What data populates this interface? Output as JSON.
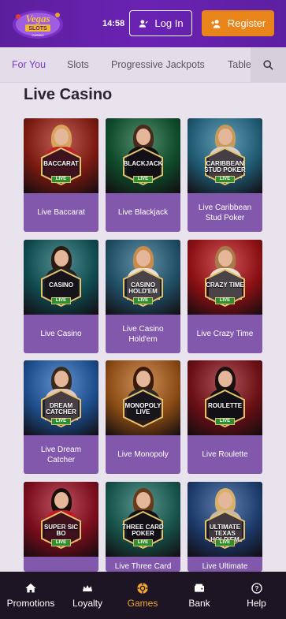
{
  "header": {
    "logo_text": "Vegas SLOTS CASINO",
    "time": "14:58",
    "login_label": "Log In",
    "register_label": "Register"
  },
  "tabs": [
    {
      "label": "For You",
      "active": true
    },
    {
      "label": "Slots",
      "active": false
    },
    {
      "label": "Progressive Jackpots",
      "active": false
    },
    {
      "label": "Table",
      "active": false
    }
  ],
  "section": {
    "title": "Live Casino"
  },
  "games": [
    {
      "label": "Live Baccarat",
      "badge": "BACCARAT",
      "live": "LIVE",
      "theme": "#7a1a10"
    },
    {
      "label": "Live Blackjack",
      "badge": "BLACKJACK",
      "live": "LIVE",
      "theme": "#0e4a2a"
    },
    {
      "label": "Live Caribbean Stud Poker",
      "badge": "CARIBBEAN STUD POKER",
      "live": "LIVE",
      "theme": "#1f5a72"
    },
    {
      "label": "Live Casino",
      "badge": "CASINO",
      "live": "LIVE",
      "theme": "#0f4a4f"
    },
    {
      "label": "Live Casino Hold'em",
      "badge": "CASINO HOLD'EM",
      "live": "LIVE",
      "theme": "#1f4e64"
    },
    {
      "label": "Live Crazy Time",
      "badge": "CRAZY TIME",
      "live": "LIVE",
      "theme": "#8a1013"
    },
    {
      "label": "Live Dream Catcher",
      "badge": "DREAM CATCHER",
      "live": "LIVE",
      "theme": "#1c4d8a"
    },
    {
      "label": "Live Monopoly",
      "badge": "MONOPOLY LIVE",
      "live": "",
      "theme": "#8a4b14"
    },
    {
      "label": "Live Roulette",
      "badge": "ROULETTE",
      "live": "LIVE",
      "theme": "#6a0f14"
    },
    {
      "label": "",
      "badge": "SUPER SIC BO",
      "live": "LIVE",
      "theme": "#7a0d1c"
    },
    {
      "label": "Live Three Card",
      "badge": "THREE CARD POKER",
      "live": "LIVE",
      "theme": "#16524a"
    },
    {
      "label": "Live Ultimate",
      "badge": "ULTIMATE TEXAS HOLD'EM",
      "live": "LIVE",
      "theme": "#1c3a6a"
    }
  ],
  "bottom_nav": [
    {
      "label": "Promotions",
      "icon": "home-icon",
      "active": false
    },
    {
      "label": "Loyalty",
      "icon": "crown-icon",
      "active": false
    },
    {
      "label": "Games",
      "icon": "chip-icon",
      "active": true
    },
    {
      "label": "Bank",
      "icon": "wallet-icon",
      "active": false
    },
    {
      "label": "Help",
      "icon": "help-icon",
      "active": false
    }
  ]
}
